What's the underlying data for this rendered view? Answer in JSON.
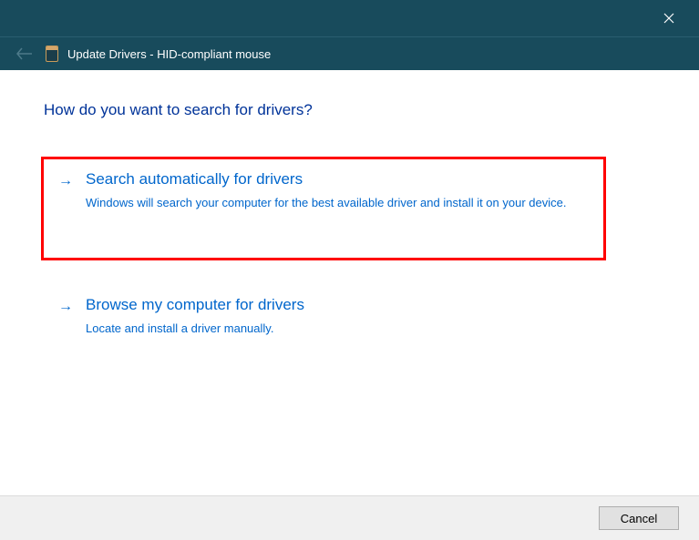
{
  "titlebar": {
    "close_icon": "close"
  },
  "header": {
    "title": "Update Drivers - HID-compliant mouse"
  },
  "content": {
    "heading": "How do you want to search for drivers?",
    "options": [
      {
        "title": "Search automatically for drivers",
        "description": "Windows will search your computer for the best available driver and install it on your device.",
        "highlighted": true
      },
      {
        "title": "Browse my computer for drivers",
        "description": "Locate and install a driver manually.",
        "highlighted": false
      }
    ]
  },
  "footer": {
    "cancel_label": "Cancel"
  }
}
